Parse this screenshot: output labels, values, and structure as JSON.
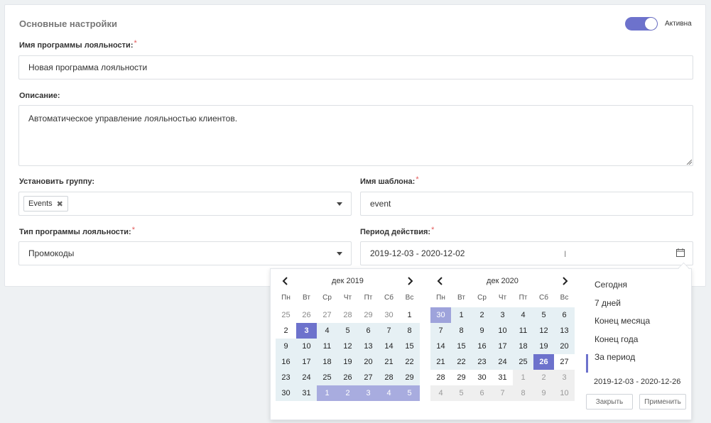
{
  "section": {
    "title": "Основные настройки"
  },
  "toggle": {
    "label": "Активна",
    "on": true
  },
  "fields": {
    "name": {
      "label": "Имя программы лояльности:",
      "value": "Новая программа лояльности"
    },
    "description": {
      "label": "Описание:",
      "value": "Автоматическое управление лояльностью клиентов."
    },
    "group": {
      "label": "Установить группу:",
      "tag": "Events"
    },
    "template": {
      "label": "Имя шаблона:",
      "value": "event"
    },
    "type": {
      "label": "Тип программы лояльности:",
      "value": "Промокоды"
    },
    "period": {
      "label": "Период действия:",
      "value": "2019-12-03 - 2020-12-02"
    }
  },
  "required_mark": "*",
  "datepicker": {
    "weekdays": [
      "Пн",
      "Вт",
      "Ср",
      "Чт",
      "Пт",
      "Сб",
      "Вс"
    ],
    "left": {
      "month": "дек 2019",
      "days": [
        [
          "25",
          "off"
        ],
        [
          "26",
          "off"
        ],
        [
          "27",
          "off"
        ],
        [
          "28",
          "off"
        ],
        [
          "29",
          "off"
        ],
        [
          "30",
          "off"
        ],
        [
          "1",
          ""
        ],
        [
          "2",
          ""
        ],
        [
          "3",
          "sel"
        ],
        [
          "4",
          "in"
        ],
        [
          "5",
          "in"
        ],
        [
          "6",
          "in"
        ],
        [
          "7",
          "in"
        ],
        [
          "8",
          "in"
        ],
        [
          "9",
          "in"
        ],
        [
          "10",
          "in"
        ],
        [
          "11",
          "in"
        ],
        [
          "12",
          "in"
        ],
        [
          "13",
          "in"
        ],
        [
          "14",
          "in"
        ],
        [
          "15",
          "in"
        ],
        [
          "16",
          "in"
        ],
        [
          "17",
          "in"
        ],
        [
          "18",
          "in"
        ],
        [
          "19",
          "in"
        ],
        [
          "20",
          "in"
        ],
        [
          "21",
          "in"
        ],
        [
          "22",
          "in"
        ],
        [
          "23",
          "in"
        ],
        [
          "24",
          "in"
        ],
        [
          "25",
          "in"
        ],
        [
          "26",
          "in"
        ],
        [
          "27",
          "in"
        ],
        [
          "28",
          "in"
        ],
        [
          "29",
          "in"
        ],
        [
          "30",
          "in"
        ],
        [
          "31",
          "in"
        ],
        [
          "1",
          "offpale"
        ],
        [
          "2",
          "offpale"
        ],
        [
          "3",
          "offpale"
        ],
        [
          "4",
          "offpale"
        ],
        [
          "5",
          "offpale"
        ]
      ]
    },
    "right": {
      "month": "дек 2020",
      "days": [
        [
          "30",
          "selpale"
        ],
        [
          "1",
          "in"
        ],
        [
          "2",
          "in"
        ],
        [
          "3",
          "in"
        ],
        [
          "4",
          "in"
        ],
        [
          "5",
          "in"
        ],
        [
          "6",
          "in"
        ],
        [
          "7",
          "in"
        ],
        [
          "8",
          "in"
        ],
        [
          "9",
          "in"
        ],
        [
          "10",
          "in"
        ],
        [
          "11",
          "in"
        ],
        [
          "12",
          "in"
        ],
        [
          "13",
          "in"
        ],
        [
          "14",
          "in"
        ],
        [
          "15",
          "in"
        ],
        [
          "16",
          "in"
        ],
        [
          "17",
          "in"
        ],
        [
          "18",
          "in"
        ],
        [
          "19",
          "in"
        ],
        [
          "20",
          "in"
        ],
        [
          "21",
          "in"
        ],
        [
          "22",
          "in"
        ],
        [
          "23",
          "in"
        ],
        [
          "24",
          "in"
        ],
        [
          "25",
          "in"
        ],
        [
          "26",
          "sel"
        ],
        [
          "27",
          ""
        ],
        [
          "28",
          ""
        ],
        [
          "29",
          ""
        ],
        [
          "30",
          ""
        ],
        [
          "31",
          ""
        ],
        [
          "1",
          "offgray"
        ],
        [
          "2",
          "offgray"
        ],
        [
          "3",
          "offgray"
        ],
        [
          "4",
          "offgray"
        ],
        [
          "5",
          "offgray"
        ],
        [
          "6",
          "offgray"
        ],
        [
          "7",
          "offgray"
        ],
        [
          "8",
          "offgray"
        ],
        [
          "9",
          "offgray"
        ],
        [
          "10",
          "offgray"
        ]
      ]
    },
    "ranges": [
      "Сегодня",
      "7 дней",
      "Конец месяца",
      "Конец года",
      "За период"
    ],
    "active_range": "За период",
    "selected_text": "2019-12-03 - 2020-12-26",
    "close_label": "Закрыть",
    "apply_label": "Применить"
  },
  "colors": {
    "accent": "#6d72cc",
    "range": "#e6f0f4",
    "required": "#e35b5b"
  },
  "icons": [
    "chevron-left-icon",
    "chevron-right-icon",
    "calendar-icon",
    "close-icon",
    "caret-down-icon"
  ]
}
